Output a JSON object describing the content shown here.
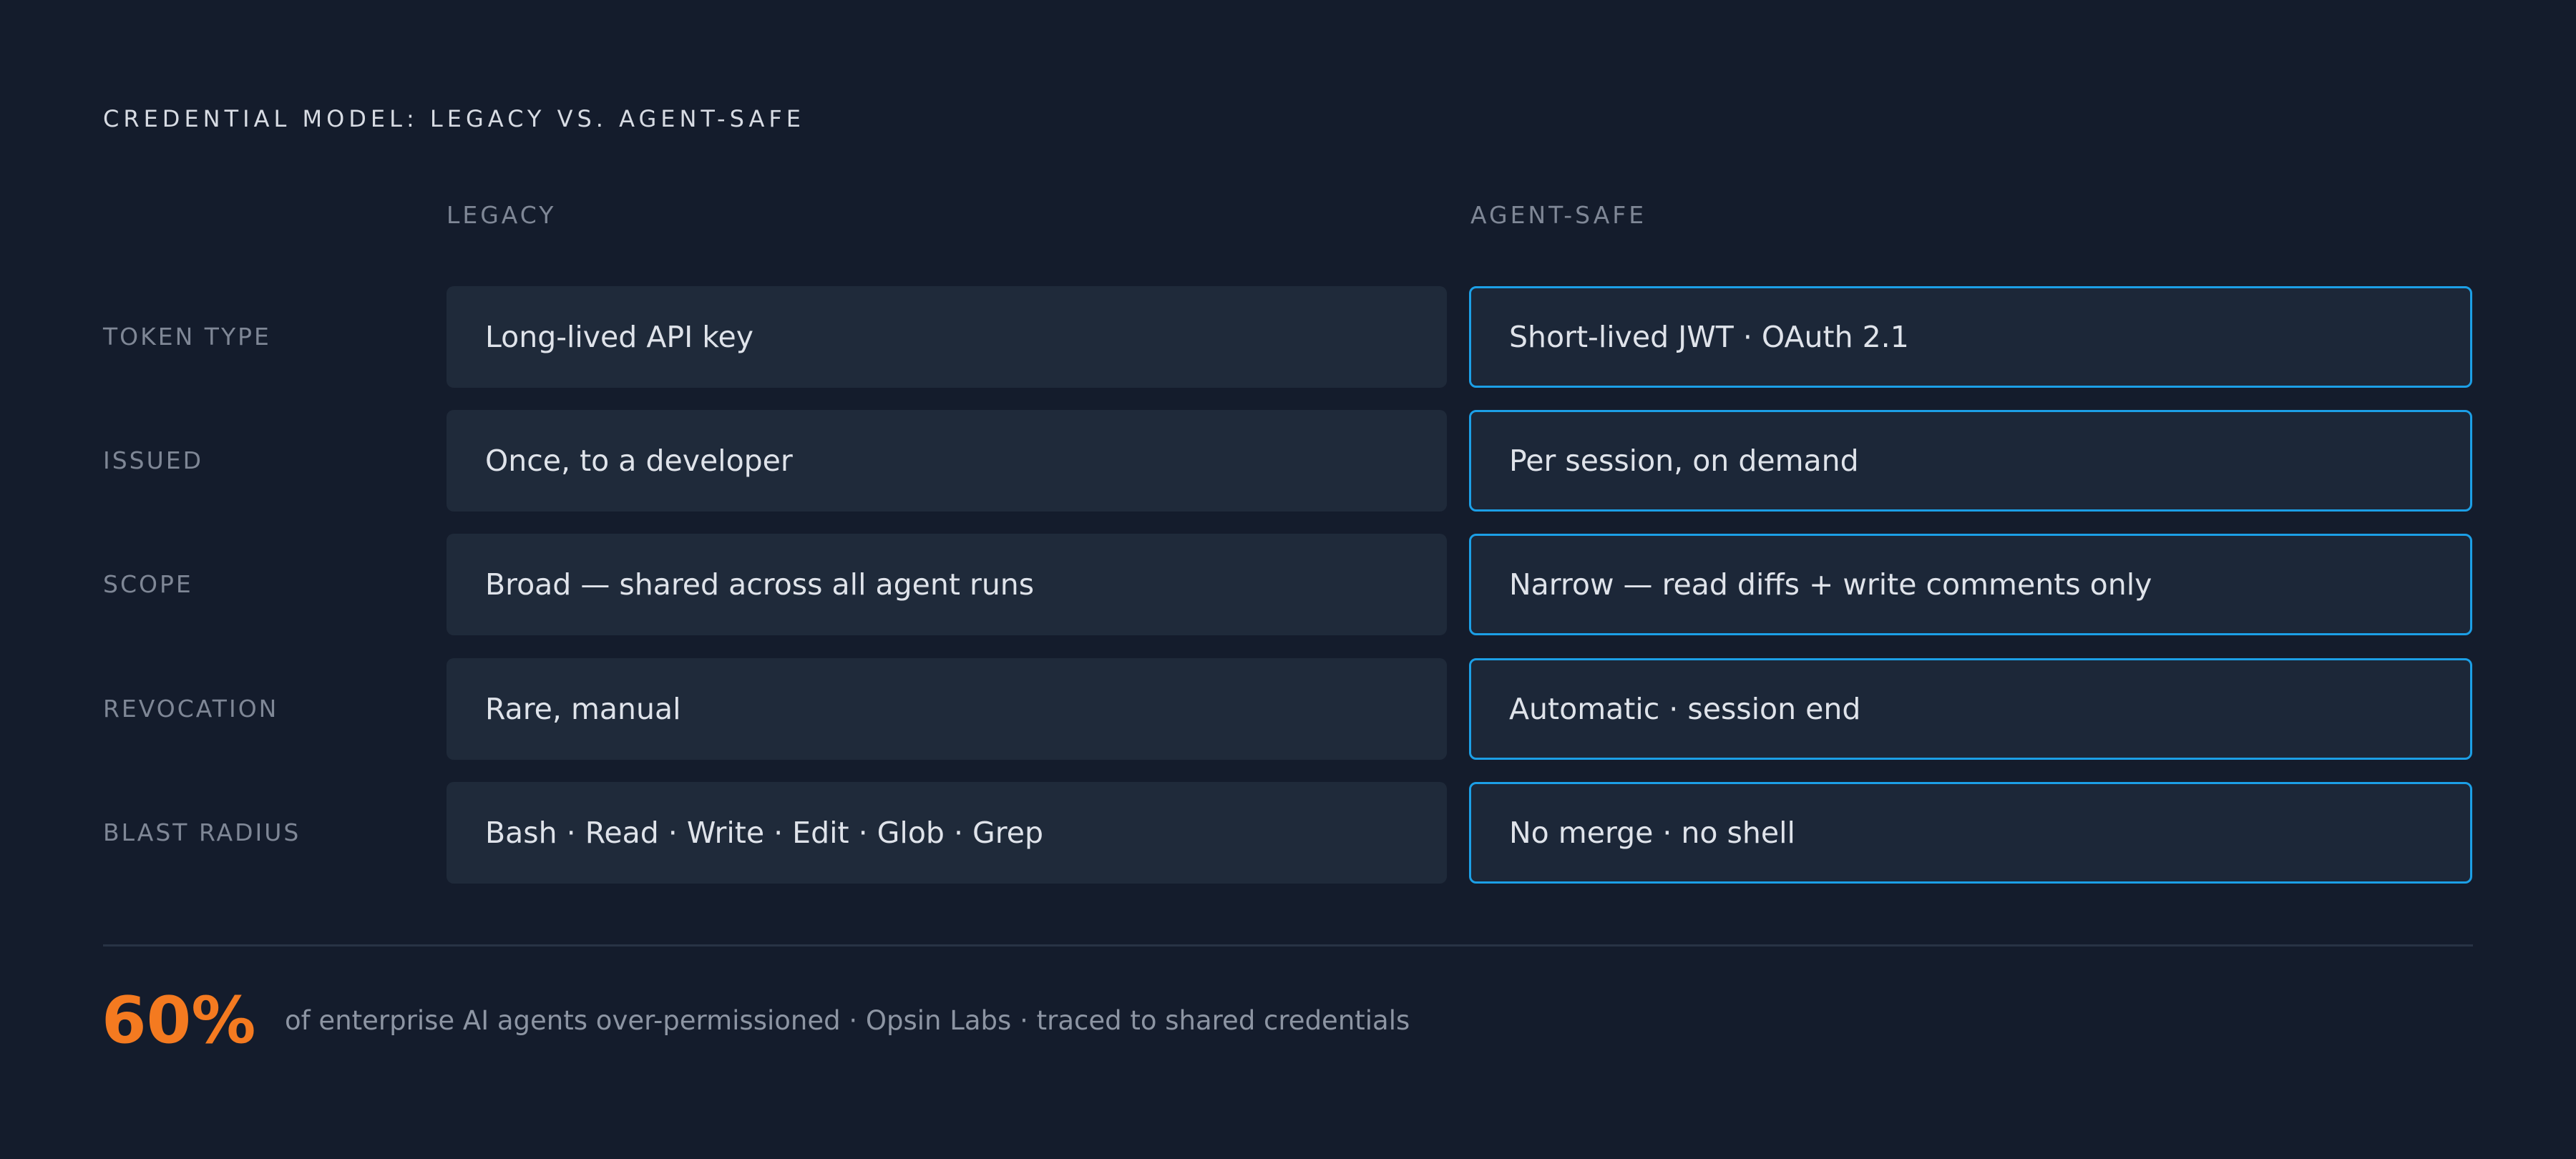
{
  "title": "CREDENTIAL MODEL: LEGACY VS. AGENT-SAFE",
  "columns": {
    "legacy": "LEGACY",
    "agent_safe": "AGENT-SAFE"
  },
  "rows": [
    {
      "label": "TOKEN TYPE",
      "legacy": "Long-lived API key",
      "agent_safe": "Short-lived JWT · OAuth 2.1"
    },
    {
      "label": "ISSUED",
      "legacy": "Once, to a developer",
      "agent_safe": "Per session, on demand"
    },
    {
      "label": "SCOPE",
      "legacy": "Broad — shared across all agent runs",
      "agent_safe": "Narrow — read diffs + write comments only"
    },
    {
      "label": "REVOCATION",
      "legacy": "Rare, manual",
      "agent_safe": "Automatic · session end"
    },
    {
      "label": "BLAST RADIUS",
      "legacy": "Bash · Read · Write · Edit · Glob · Grep",
      "agent_safe": "No merge · no shell"
    }
  ],
  "stat": {
    "value": "60%",
    "caption": "of enterprise AI agents over-permissioned · Opsin Labs · traced to shared credentials"
  },
  "colors": {
    "background": "#141c2c",
    "legacy_cell": "#1f2a3a",
    "agent_safe_border": "#1c9fe6",
    "stat_accent": "#f47a20"
  }
}
